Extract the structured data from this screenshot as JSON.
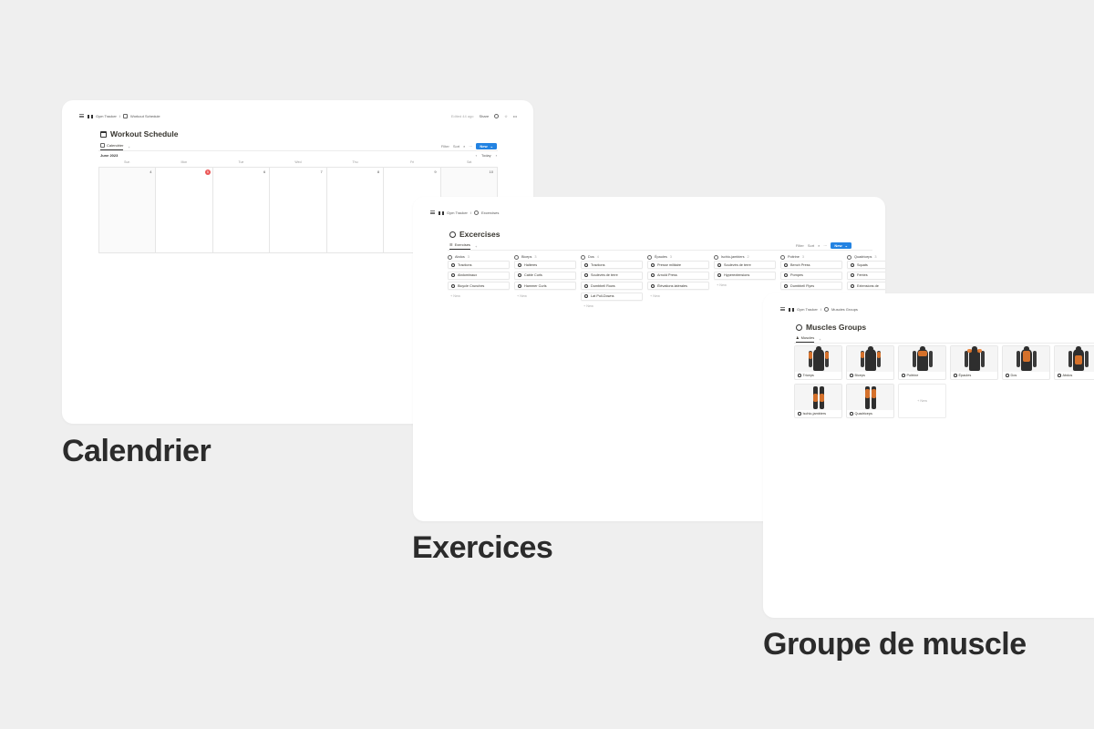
{
  "calendar_window": {
    "breadcrumb": [
      "Gym Tracker",
      "/",
      "Workout Schedule"
    ],
    "edited": "Edited 44 ago",
    "share": "Share",
    "title": "Workout Schedule",
    "view_tab": "Calendrier",
    "toolbar": {
      "filter": "Filter",
      "sort": "Sort",
      "new": "New"
    },
    "month": "June 2023",
    "nav": {
      "prev": "‹",
      "today": "Today",
      "next": "›"
    },
    "weekdays": [
      "Sun",
      "Mon",
      "Tue",
      "Wed",
      "Thu",
      "Fri",
      "Sat"
    ],
    "days": [
      "4",
      "5",
      "6",
      "7",
      "8",
      "9",
      "10"
    ],
    "today_index": 1
  },
  "exercises_window": {
    "breadcrumb": [
      "Gym Tracker",
      "/",
      "Excercises"
    ],
    "title": "Excercises",
    "view_tab": "Exercises",
    "toolbar": {
      "filter": "Filter",
      "sort": "Sort",
      "new": "New"
    },
    "new_label": "+ New",
    "columns": [
      {
        "name": "Abdos",
        "count": "3",
        "cards": [
          "Tractions",
          "Abdominaux",
          "Bicycle Crunches"
        ]
      },
      {
        "name": "Biceps",
        "count": "3",
        "cards": [
          "Halteres",
          "Cable Curls",
          "Hammer Curls"
        ]
      },
      {
        "name": "Dos",
        "count": "4",
        "cards": [
          "Tractions",
          "Soulevés de terre",
          "Dumbbell Rows",
          "Lat Pull-Downs"
        ]
      },
      {
        "name": "Épaules",
        "count": "3",
        "cards": [
          "Presse militaire",
          "Arnold Press",
          "Élévations latérales"
        ]
      },
      {
        "name": "Ischio-jambiers",
        "count": "2",
        "cards": [
          "Soulevés de terre",
          "Hyperextensions"
        ]
      },
      {
        "name": "Poitrine",
        "count": "3",
        "cards": [
          "Bench Press",
          "Pompes",
          "Dumbbell Flyes"
        ]
      },
      {
        "name": "Quadriceps",
        "count": "3",
        "cards": [
          "Squats",
          "Fentes",
          "Extensions de"
        ]
      }
    ]
  },
  "muscles_window": {
    "breadcrumb": [
      "Gym Tracker",
      "/",
      "Muscles Groups"
    ],
    "title": "Muscles Groups",
    "view_tab": "Muscles",
    "new_label": "+ New",
    "cards": [
      "Triceps",
      "Biceps",
      "Poitrine",
      "Épaules",
      "Dos",
      "Abdos",
      "Ischio-jambiers",
      "Quadriceps"
    ]
  },
  "captions": {
    "calendar": "Calendrier",
    "exercises": "Exercices",
    "muscles": "Groupe de muscle"
  },
  "colors": {
    "accent": "#2383e2",
    "today": "#eb5757",
    "highlight": "#e8792b"
  }
}
